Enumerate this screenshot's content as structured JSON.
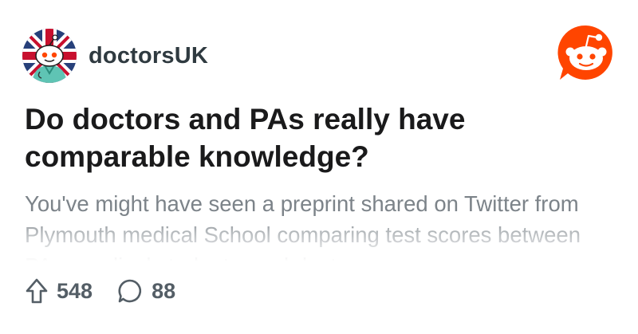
{
  "post": {
    "subreddit": "doctorsUK",
    "title": "Do doctors and PAs really have comparable knowledge?",
    "body": "You've might have seen a preprint shared on Twitter from Plymouth medical School comparing test scores between PAs, medical students, and doctors.",
    "upvotes": "548",
    "comments": "88"
  },
  "icons": {
    "avatar": "subreddit-avatar-union-jack-snoo",
    "logo": "reddit-logo-icon",
    "upvote": "upvote-arrow-icon",
    "comment": "comment-bubble-icon"
  },
  "colors": {
    "reddit_orange": "#ff4500",
    "title_text": "#1a1a1b",
    "body_text": "#7c8389",
    "meta_text": "#545e66"
  }
}
